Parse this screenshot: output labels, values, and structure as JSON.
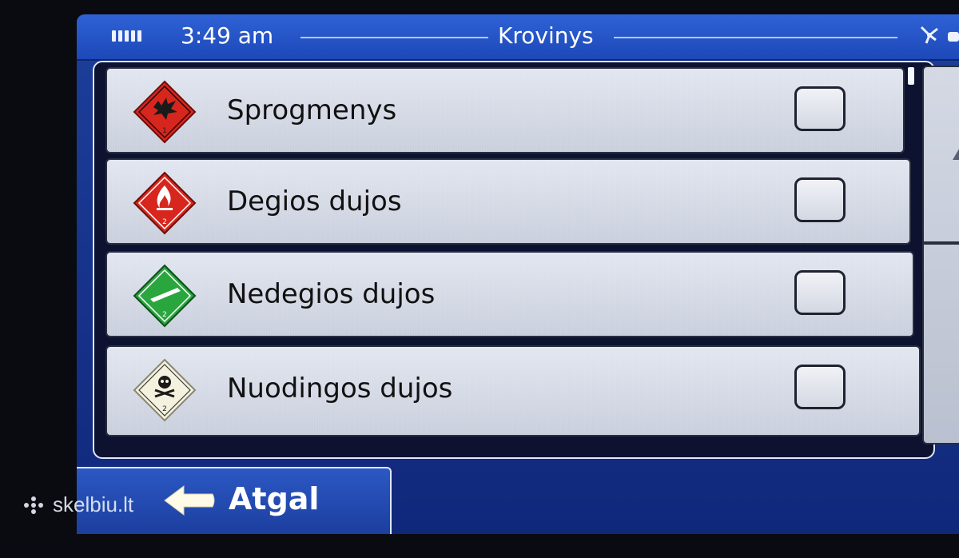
{
  "status_bar": {
    "time": "3:49 am",
    "title": "Krovinys",
    "signal_icon": "battery-bars-icon",
    "satellite_icon": "satellite-icon"
  },
  "list": {
    "items": [
      {
        "label": "Sprogmenys",
        "icon": "explosive-hazard-icon",
        "checked": false
      },
      {
        "label": "Degios dujos",
        "icon": "flammable-gas-hazard-icon",
        "checked": false
      },
      {
        "label": "Nedegios dujos",
        "icon": "non-flammable-gas-hazard-icon",
        "checked": false
      },
      {
        "label": "Nuodingos dujos",
        "icon": "toxic-gas-hazard-icon",
        "checked": false
      }
    ]
  },
  "footer": {
    "back_label": "Atgal",
    "back_icon": "back-arrow-icon"
  },
  "watermark": {
    "text": "skelbiu.lt"
  },
  "colors": {
    "header_blue": "#1d48b8",
    "row_gray": "#d6dbe6",
    "explosive_orange": "#d7261e",
    "flammable_red": "#d7261e",
    "nonflammable_green": "#2aa63e",
    "toxic_white": "#f4f1df"
  }
}
